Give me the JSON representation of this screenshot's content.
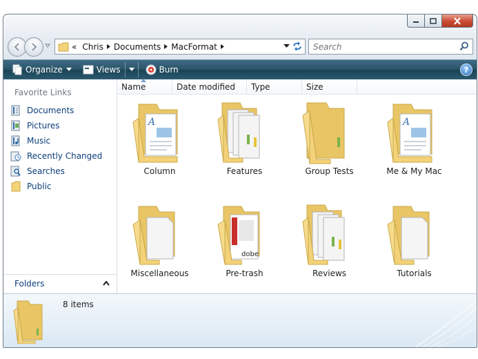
{
  "window": {
    "caption_buttons": [
      "minimize",
      "maximize",
      "close"
    ]
  },
  "address": {
    "prefix": "«",
    "crumbs": [
      "Chris",
      "Documents",
      "MacFormat"
    ]
  },
  "search": {
    "placeholder": "Search"
  },
  "toolbar": {
    "organize_label": "Organize",
    "views_label": "Views",
    "burn_label": "Burn",
    "help_label": "?"
  },
  "nav_pane": {
    "favorites_title": "Favorite Links",
    "items": [
      {
        "label": "Documents",
        "icon": "documents-icon"
      },
      {
        "label": "Pictures",
        "icon": "pictures-icon"
      },
      {
        "label": "Music",
        "icon": "music-icon"
      },
      {
        "label": "Recently Changed",
        "icon": "recently-changed-icon"
      },
      {
        "label": "Searches",
        "icon": "searches-icon"
      },
      {
        "label": "Public",
        "icon": "public-folder-icon"
      }
    ],
    "folders_label": "Folders"
  },
  "columns": [
    "Name",
    "Date modified",
    "Type",
    "Size"
  ],
  "items": [
    {
      "name": "Column",
      "kind": "folder-document"
    },
    {
      "name": "Features",
      "kind": "folder-stack"
    },
    {
      "name": "Group Tests",
      "kind": "folder-empty"
    },
    {
      "name": "Me & My Mac",
      "kind": "folder-document"
    },
    {
      "name": "Miscellaneous",
      "kind": "folder-blank"
    },
    {
      "name": "Pre-trash",
      "kind": "folder-pdf"
    },
    {
      "name": "Reviews",
      "kind": "folder-stack"
    },
    {
      "name": "Tutorials",
      "kind": "folder-blank"
    }
  ],
  "details": {
    "count_text": "8 items"
  },
  "colors": {
    "toolbar": "#2a5468",
    "link": "#0c3e7b",
    "folder": "#f3d27a",
    "close_button": "#c94c33"
  }
}
